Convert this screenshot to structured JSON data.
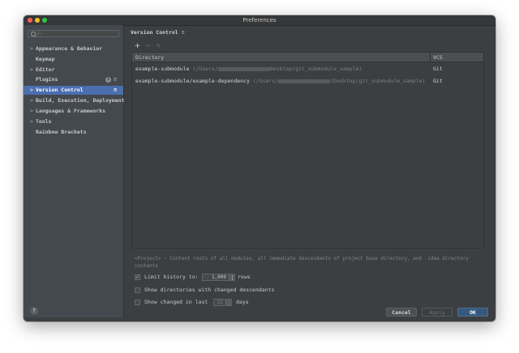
{
  "window": {
    "title": "Preferences"
  },
  "sidebar": {
    "search_placeholder": "Q→",
    "items": [
      {
        "label": "Appearance & Behavior",
        "expandable": true
      },
      {
        "label": "Keymap",
        "expandable": false
      },
      {
        "label": "Editor",
        "expandable": true
      },
      {
        "label": "Plugins",
        "expandable": false,
        "badge": "1"
      },
      {
        "label": "Version Control",
        "expandable": true,
        "selected": true
      },
      {
        "label": "Build, Execution, Deployment",
        "expandable": true
      },
      {
        "label": "Languages & Frameworks",
        "expandable": true
      },
      {
        "label": "Tools",
        "expandable": true
      },
      {
        "label": "Rainbow Brackets",
        "expandable": false
      }
    ],
    "help_label": "?"
  },
  "main": {
    "breadcrumb": "Version Control",
    "toolbar": {
      "add": "+",
      "remove": "−",
      "edit": "✎"
    },
    "table": {
      "columns": [
        "Directory",
        "VCS"
      ],
      "rows": [
        {
          "name": "example-submodule",
          "path_prefix": "(/Users/",
          "path_suffix": "Desktop/git_submodule_sample)",
          "vcs": "Git"
        },
        {
          "name": "example-submodule/example-dependency",
          "path_prefix": "(/Users/",
          "path_suffix": "/Desktop/git_submodule_sample)",
          "vcs": "Git"
        }
      ]
    },
    "note": "<Project> - Content roots of all modules, all immediate descendants of project base directory, and .idea directory contents",
    "options": {
      "limit_history": {
        "label": "Limit history to:",
        "checked": true,
        "value": "1,000",
        "unit": "rows"
      },
      "show_changed_descendants": {
        "label": "Show directories with changed descendants",
        "checked": false
      },
      "show_changed_in_last": {
        "label": "Show changed in last",
        "checked": false,
        "value": "31",
        "unit": "days"
      }
    }
  },
  "footer": {
    "cancel": "Cancel",
    "apply": "Apply",
    "ok": "OK"
  },
  "colors": {
    "accent": "#4b6eaf",
    "ok_button": "#365880",
    "background": "#3c3f41",
    "sidebar": "#44494f"
  }
}
